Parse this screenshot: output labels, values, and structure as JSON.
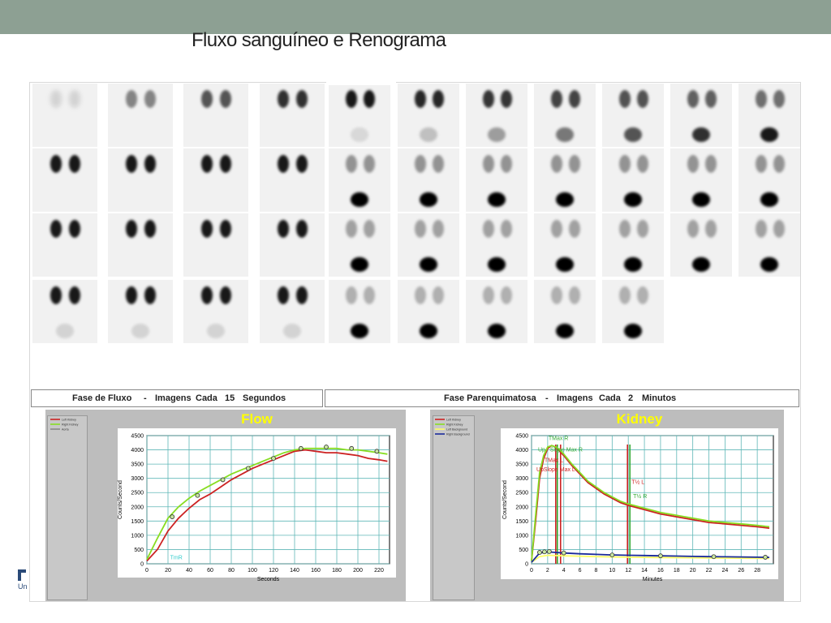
{
  "slide": {
    "title": "Fluxo sanguíneo e Renograma"
  },
  "captions": {
    "flow_phase": [
      "Fase de Fluxo",
      "-",
      "Imagens",
      "Cada",
      "15",
      "Segundos"
    ],
    "parenchymal_phase": [
      "Fase Parenquimatosa",
      "-",
      "Imagens",
      "Cada",
      "2",
      "Minutos"
    ]
  },
  "logo": {
    "text": "Un"
  },
  "chart_data": [
    {
      "type": "line",
      "title": "Flow",
      "xlabel": "Seconds",
      "ylabel": "Counts/Second",
      "xlim": [
        0,
        230
      ],
      "ylim": [
        0,
        4500
      ],
      "xticks": [
        0,
        20,
        40,
        60,
        80,
        100,
        120,
        140,
        160,
        180,
        200,
        220
      ],
      "yticks": [
        0,
        500,
        1000,
        1500,
        2000,
        2500,
        3000,
        3500,
        4000,
        4500
      ],
      "grid": true,
      "legend_position": "top-left (separate box)",
      "legend": [
        "Left Kidney",
        "Right Kidney",
        "Aorta"
      ],
      "annotations": [
        {
          "text": "TmR",
          "x": 22,
          "y": 150,
          "color": "#33cccc"
        }
      ],
      "series": [
        {
          "name": "Left Kidney",
          "color": "#cc2222",
          "x": [
            0,
            10,
            20,
            30,
            40,
            50,
            60,
            70,
            80,
            90,
            100,
            110,
            120,
            130,
            140,
            150,
            160,
            170,
            180,
            190,
            200,
            210,
            220,
            228
          ],
          "y": [
            100,
            500,
            1150,
            1600,
            1950,
            2250,
            2450,
            2700,
            2950,
            3150,
            3350,
            3500,
            3650,
            3800,
            3950,
            4000,
            3950,
            3900,
            3900,
            3850,
            3800,
            3700,
            3650,
            3600
          ]
        },
        {
          "name": "Right Kidney",
          "color": "#88dd22",
          "x": [
            0,
            10,
            20,
            30,
            40,
            50,
            60,
            70,
            80,
            90,
            100,
            110,
            120,
            130,
            140,
            150,
            160,
            170,
            180,
            190,
            200,
            210,
            220,
            228
          ],
          "y": [
            150,
            900,
            1600,
            2000,
            2300,
            2550,
            2750,
            2950,
            3150,
            3300,
            3450,
            3600,
            3750,
            3900,
            4000,
            4050,
            4050,
            4050,
            4050,
            4000,
            4000,
            3950,
            3900,
            3850
          ]
        }
      ],
      "markers": [
        {
          "x": 24,
          "y": 1650
        },
        {
          "x": 48,
          "y": 2400
        },
        {
          "x": 72,
          "y": 2950
        },
        {
          "x": 96,
          "y": 3350
        },
        {
          "x": 120,
          "y": 3700
        },
        {
          "x": 146,
          "y": 4050
        },
        {
          "x": 170,
          "y": 4100
        },
        {
          "x": 194,
          "y": 4050
        },
        {
          "x": 218,
          "y": 3950
        }
      ]
    },
    {
      "type": "line",
      "title": "Kidney",
      "xlabel": "Minutes",
      "ylabel": "Counts/Second",
      "xlim": [
        0,
        30
      ],
      "ylim": [
        0,
        4500
      ],
      "xticks": [
        0,
        2,
        4,
        6,
        8,
        10,
        12,
        14,
        16,
        18,
        20,
        22,
        24,
        26,
        28
      ],
      "yticks": [
        0,
        500,
        1000,
        1500,
        2000,
        2500,
        3000,
        3500,
        4000,
        4500
      ],
      "grid": true,
      "legend_position": "top-left (separate box)",
      "legend": [
        "Left Kidney",
        "Right Kidney",
        "Left Background",
        "Right Background"
      ],
      "annotations": [
        {
          "text": "TMax R",
          "x": 2.1,
          "y": 4350,
          "color": "#33aa33"
        },
        {
          "text": "Up",
          "x": 0.8,
          "y": 3950,
          "color": "#33aa33"
        },
        {
          "text": "Slope Max R",
          "x": 2.3,
          "y": 3950,
          "color": "#33aa33"
        },
        {
          "text": "TMax L",
          "x": 1.6,
          "y": 3580,
          "color": "#cc2222"
        },
        {
          "text": "UpSlope Max L",
          "x": 0.6,
          "y": 3250,
          "color": "#cc2222"
        },
        {
          "text": "T½ L",
          "x": 12.4,
          "y": 2800,
          "color": "#cc2222"
        },
        {
          "text": "T½ R",
          "x": 12.6,
          "y": 2300,
          "color": "#33aa33"
        }
      ],
      "vlines": [
        {
          "x": 3.0,
          "color": "#cc2222"
        },
        {
          "x": 3.2,
          "color": "#33aa33"
        },
        {
          "x": 3.6,
          "color": "#cc2222"
        },
        {
          "x": 11.9,
          "color": "#cc2222"
        },
        {
          "x": 12.2,
          "color": "#33aa33"
        }
      ],
      "series": [
        {
          "name": "Left Kidney",
          "color": "#cc2222",
          "x": [
            0,
            0.5,
            1,
            1.5,
            2,
            2.5,
            3,
            3.5,
            4,
            5,
            6,
            7,
            8,
            9,
            10,
            11,
            12,
            14,
            16,
            18,
            20,
            22,
            24,
            26,
            28,
            29.5
          ],
          "y": [
            100,
            1500,
            3000,
            3700,
            4050,
            4150,
            4100,
            3950,
            3800,
            3450,
            3150,
            2850,
            2650,
            2450,
            2300,
            2150,
            2050,
            1900,
            1750,
            1650,
            1550,
            1450,
            1400,
            1350,
            1300,
            1250
          ]
        },
        {
          "name": "Right Kidney",
          "color": "#88dd22",
          "x": [
            0,
            0.5,
            1,
            1.5,
            2,
            2.5,
            3,
            3.5,
            4,
            5,
            6,
            7,
            8,
            9,
            10,
            11,
            12,
            14,
            16,
            18,
            20,
            22,
            24,
            26,
            28,
            29.5
          ],
          "y": [
            100,
            1700,
            3200,
            3800,
            4100,
            4150,
            4100,
            4000,
            3850,
            3500,
            3200,
            2900,
            2700,
            2500,
            2350,
            2200,
            2100,
            1950,
            1800,
            1700,
            1600,
            1500,
            1450,
            1400,
            1350,
            1300
          ]
        },
        {
          "name": "Left Background",
          "color": "#ffff66",
          "x": [
            0,
            1,
            2,
            4,
            8,
            12,
            16,
            20,
            24,
            29.5
          ],
          "y": [
            50,
            250,
            300,
            280,
            250,
            230,
            220,
            210,
            200,
            190
          ]
        },
        {
          "name": "Right Background",
          "color": "#1a2a9a",
          "x": [
            0,
            1,
            2,
            3,
            4,
            6,
            8,
            10,
            12,
            14,
            16,
            18,
            20,
            22,
            24,
            26,
            28,
            29.5
          ],
          "y": [
            50,
            380,
            420,
            400,
            380,
            350,
            330,
            310,
            300,
            290,
            280,
            270,
            260,
            250,
            245,
            240,
            230,
            225
          ]
        }
      ],
      "markers": [
        {
          "x": 1,
          "y": 400
        },
        {
          "x": 1.6,
          "y": 420
        },
        {
          "x": 2.2,
          "y": 430
        },
        {
          "x": 4,
          "y": 380
        },
        {
          "x": 10,
          "y": 310
        },
        {
          "x": 16,
          "y": 280
        },
        {
          "x": 22.6,
          "y": 250
        },
        {
          "x": 29,
          "y": 230
        }
      ]
    }
  ]
}
